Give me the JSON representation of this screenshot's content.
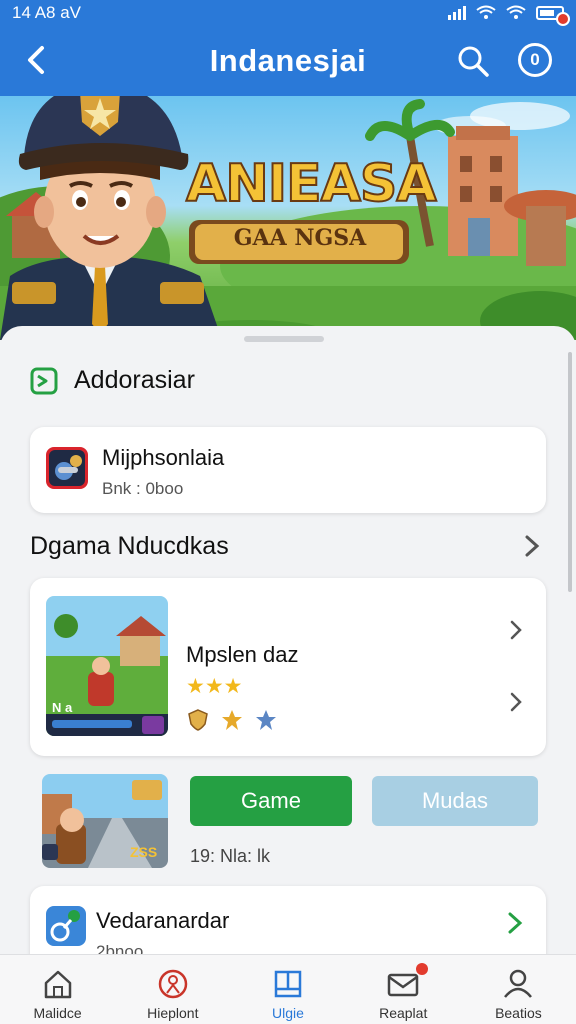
{
  "status_bar": {
    "time": "14 A8 aV"
  },
  "app_bar": {
    "title": "Indanesjai",
    "coin_label": "0"
  },
  "banner": {
    "logo_title": "ANIEASA",
    "logo_subtitle": "GAA NGSA"
  },
  "section_one": {
    "title": "Addorasiar"
  },
  "featured_app": {
    "name": "Mijphsonlaia",
    "subtitle": "Bnk : 0boo"
  },
  "section_two": {
    "title": "Dgama Nducdkas"
  },
  "game_card": {
    "name": "Mpslen daz",
    "rating_stars": "★★★",
    "thumb_label": "N a",
    "rating": 3
  },
  "promo": {
    "thumb_label": "ZSS",
    "primary_button": "Game",
    "secondary_button": "Mudas",
    "meta": "19: Nla: lk"
  },
  "list_item": {
    "name": "Vedaranardar",
    "subtitle": "2bnoo"
  },
  "bottom_nav": [
    {
      "label": "Malidce",
      "icon": "home-icon"
    },
    {
      "label": "Hieplont",
      "icon": "person-pin-icon"
    },
    {
      "label": "Ulgie",
      "icon": "square-tab-icon"
    },
    {
      "label": "Reaplat",
      "icon": "mail-icon"
    },
    {
      "label": "Beatios",
      "icon": "profile-icon"
    }
  ],
  "colors": {
    "primary": "#2a79d8",
    "accent_green": "#25a043",
    "button_secondary": "#a8cfe3",
    "notification": "#e23b2e"
  }
}
